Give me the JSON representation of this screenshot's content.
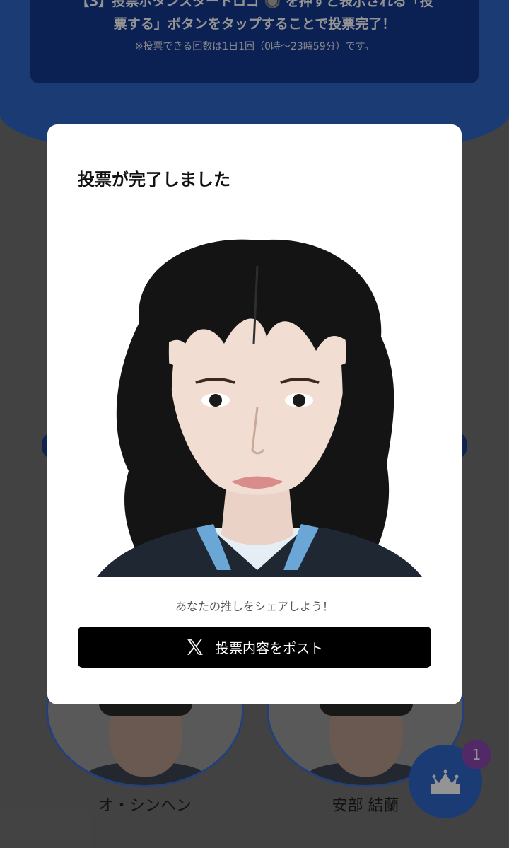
{
  "background": {
    "instructions": {
      "line1": "【3】投票ボタンスタートロゴ 🔘 を押すと表示される「投",
      "line2": "票する」ボタンをタップすることで投票完了！",
      "note": "※投票できる回数は1日1回（0時〜23時59分）です。"
    },
    "candidates": [
      {
        "name": "オ・シンヘン"
      },
      {
        "name": "安部 結蘭"
      }
    ],
    "ranking_badge": "1",
    "colors": {
      "primary": "#2d67c8",
      "dark": "#163a8f",
      "badge": "#8c48b0"
    }
  },
  "modal": {
    "title": "投票が完了しました",
    "share_text": "あなたの推しをシェアしよう！",
    "post_button_label": "投票内容をポスト",
    "post_button_icon": "x-logo-icon"
  }
}
